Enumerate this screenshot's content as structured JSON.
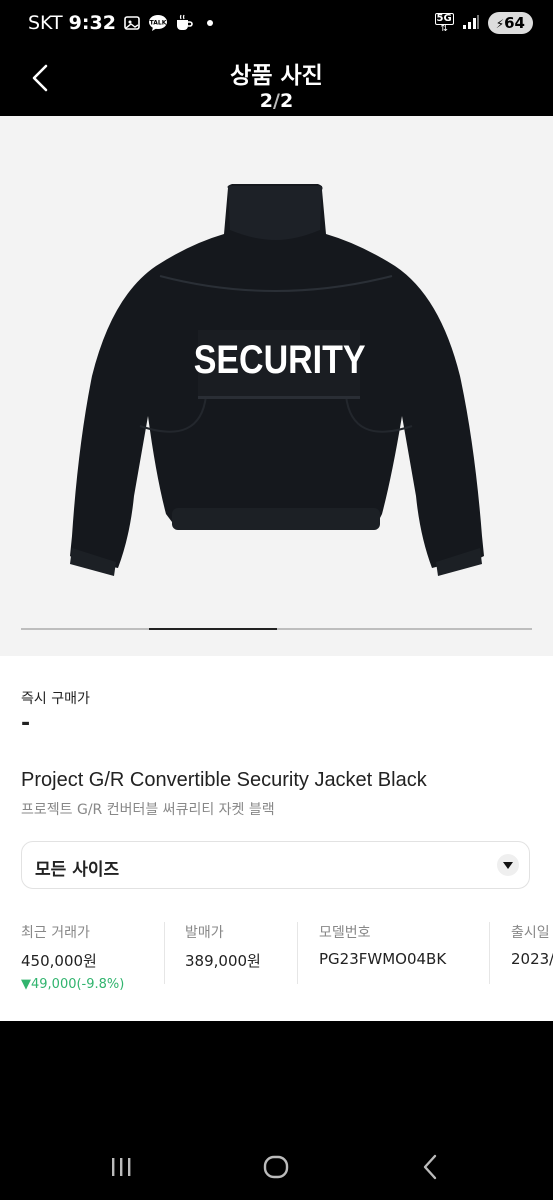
{
  "status_bar": {
    "carrier": "SKT",
    "time": "9:32",
    "network": "5G",
    "battery": "64"
  },
  "header": {
    "title": "상품 사진",
    "page_current": "2",
    "page_separator": "/",
    "page_total": "2"
  },
  "gallery": {
    "print_text": "SECURITY",
    "progress_fraction": 0.5,
    "slide_index": 2,
    "slide_count": 2
  },
  "product": {
    "instant_buy_label": "즉시 구매가",
    "instant_buy_value": "-",
    "name_en": "Project G/R Convertible Security Jacket Black",
    "name_ko": "프로젝트 G/R 컨버터블 써큐리티 자켓 블랙",
    "size_select": "모든 사이즈"
  },
  "stats": {
    "recent_label": "최근 거래가",
    "recent_value": "450,000원",
    "recent_change": "▼49,000(-9.8%)",
    "release_price_label": "발매가",
    "release_price_value": "389,000원",
    "model_label": "모델번호",
    "model_value": "PG23FWMO04BK",
    "release_date_label": "출시일",
    "release_date_value": "2023/"
  },
  "colors": {
    "accent_green": "#31b46e",
    "background": "#000000",
    "photo_bg": "#f3f3f3"
  }
}
